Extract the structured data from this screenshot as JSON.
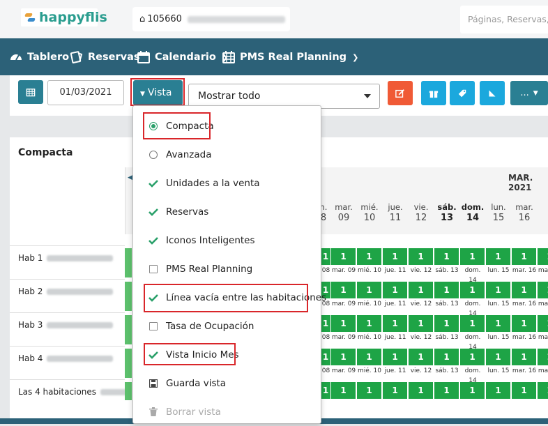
{
  "header": {
    "logo_text": "happyflis",
    "hotel_id": "105660",
    "search_placeholder": "Páginas, Reservas, Ha"
  },
  "nav": {
    "items": [
      {
        "label": "Tablero",
        "icon": "dashboard-icon"
      },
      {
        "label": "Reservas",
        "icon": "reservations-icon"
      },
      {
        "label": "Calendario",
        "icon": "calendar-icon"
      },
      {
        "label": "PMS Real Planning",
        "icon": "grid-calendar-icon"
      }
    ]
  },
  "toolbar": {
    "date_value": "01/03/2021",
    "vista_label": "Vista",
    "select_value": "Mostrar todo",
    "more_label": "..."
  },
  "panel": {
    "title": "Compacta",
    "month": "MAR. 2021"
  },
  "days": [
    {
      "dow": "n.",
      "num": "8",
      "short": "08"
    },
    {
      "dow": "mar.",
      "num": "09",
      "short": "mar. 09"
    },
    {
      "dow": "mié.",
      "num": "10",
      "short": "mié. 10"
    },
    {
      "dow": "jue.",
      "num": "11",
      "short": "jue. 11"
    },
    {
      "dow": "vie.",
      "num": "12",
      "short": "vie. 12"
    },
    {
      "dow": "sáb.",
      "num": "13",
      "short": "sáb. 13"
    },
    {
      "dow": "dom.",
      "num": "14",
      "short": "dom. 14"
    },
    {
      "dow": "lun.",
      "num": "15",
      "short": "lun. 15"
    },
    {
      "dow": "mar.",
      "num": "16",
      "short": "mar. 16"
    }
  ],
  "rooms": [
    {
      "label": "Hab 1"
    },
    {
      "label": "Hab 2"
    },
    {
      "label": "Hab 3"
    },
    {
      "label": "Hab 4"
    },
    {
      "label": "Las 4 habitaciones"
    }
  ],
  "cell_value": "1",
  "dropdown": {
    "items": [
      {
        "label": "Compacta",
        "type": "radio-on"
      },
      {
        "label": "Avanzada",
        "type": "radio-off"
      },
      {
        "label": "Unidades a la venta",
        "type": "check"
      },
      {
        "label": "Reservas",
        "type": "check"
      },
      {
        "label": "Iconos Inteligentes",
        "type": "check"
      },
      {
        "label": "PMS Real Planning",
        "type": "box"
      },
      {
        "label": "Línea vacía entre las habitaciones",
        "type": "check"
      },
      {
        "label": "Tasa de Ocupación",
        "type": "box"
      },
      {
        "label": "Vista Inicio Mes",
        "type": "check"
      },
      {
        "label": "Guarda vista",
        "type": "save"
      },
      {
        "label": "Borrar vista",
        "type": "trash"
      }
    ]
  },
  "colors": {
    "nav_bg": "#2c6178",
    "teal_button": "#2a7f93",
    "orange_button": "#f05a36",
    "cyan_button": "#1ba8dd",
    "cell_green": "#1ea446",
    "highlight_red": "#d9262a",
    "check_green": "#2aa06a"
  }
}
